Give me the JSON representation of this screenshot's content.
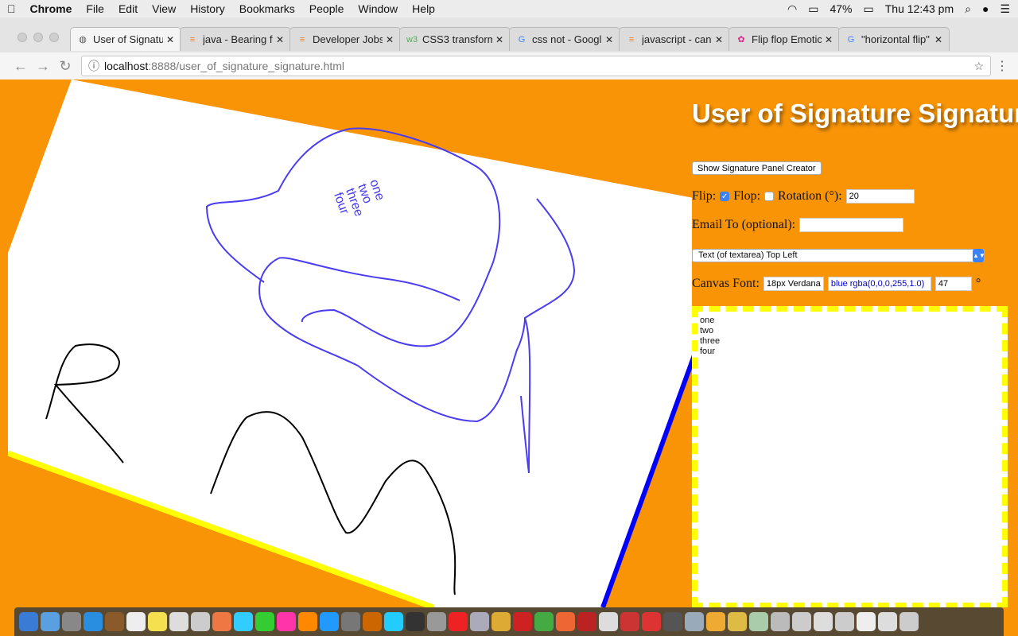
{
  "menubar": {
    "app": "Chrome",
    "items": [
      "File",
      "Edit",
      "View",
      "History",
      "Bookmarks",
      "People",
      "Window",
      "Help"
    ],
    "battery": "47%",
    "clock": "Thu 12:43 pm"
  },
  "browser": {
    "tabs": [
      {
        "title": "User of Signatu",
        "icon": "globe-icon",
        "active": true
      },
      {
        "title": "java - Bearing f",
        "icon": "stackoverflow-icon"
      },
      {
        "title": "Developer Jobs",
        "icon": "stackoverflow-icon"
      },
      {
        "title": "CSS3 transform",
        "icon": "w3schools-icon"
      },
      {
        "title": "css not - Googl",
        "icon": "google-icon"
      },
      {
        "title": "javascript - can",
        "icon": "stackoverflow-icon"
      },
      {
        "title": "Flip flop Emotic",
        "icon": "bow-icon"
      },
      {
        "title": "\"horizontal flip\"",
        "icon": "google-icon"
      }
    ],
    "url_host": "localhost",
    "url_rest": ":8888/user_of_signature_signature.html"
  },
  "page": {
    "title": "User of Signature Signature",
    "show_button": "Show Signature Panel Creator",
    "flip_label": "Flip:",
    "flip_checked": true,
    "flop_label": "Flop:",
    "flop_checked": false,
    "rotation_label": "Rotation (°):",
    "rotation_value": "20",
    "email_label": "Email To (optional):",
    "email_value": "",
    "select_value": "Text (of textarea) Top Left",
    "font_label": "Canvas Font:",
    "font_value": "18px Verdana",
    "color_value": "blue rgba(0,0,0,255,1.0)",
    "angle_value": "47",
    "degree": "°",
    "textarea": "one\ntwo\nthree\nfour",
    "canvas_text": [
      "one",
      "two",
      "three",
      "four"
    ],
    "colors": {
      "background": "#f89406",
      "canvas_border": "#ffff00",
      "edge_line": "#0000ff",
      "stroke_blue": "#4a3cf0",
      "stroke_black": "#000000"
    }
  }
}
